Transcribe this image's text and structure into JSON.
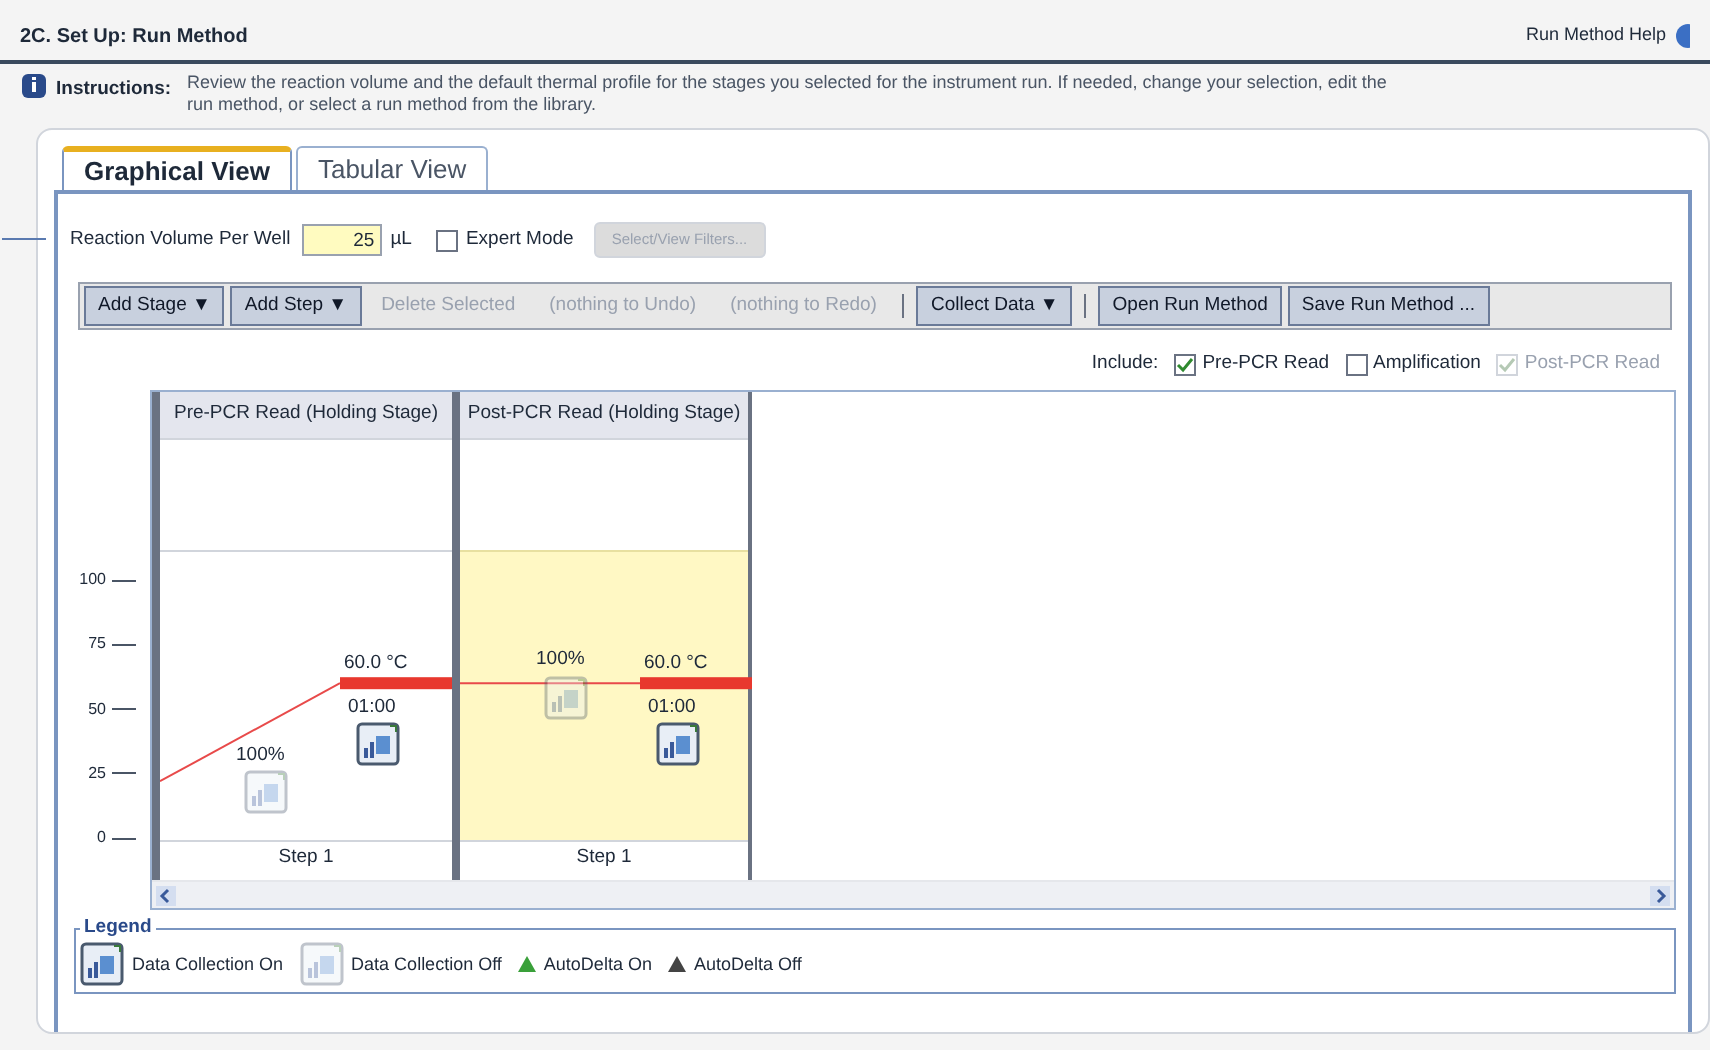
{
  "header": {
    "title": "2C. Set Up: Run Method",
    "help_link": "Run Method Help"
  },
  "instructions": {
    "label": "Instructions:",
    "text": "Review the reaction volume and the default thermal profile for the stages you selected for the instrument run. If needed, change your selection, edit the run method, or select a run method from the library."
  },
  "tabs": [
    {
      "label": "Graphical View",
      "selected": true
    },
    {
      "label": "Tabular View",
      "selected": false
    }
  ],
  "reaction_volume": {
    "label": "Reaction Volume Per Well",
    "value": "25",
    "unit": "µL"
  },
  "expert_mode": {
    "label": "Expert Mode",
    "checked": false
  },
  "filters_button": {
    "label": "Select/View Filters...",
    "disabled": true
  },
  "toolbar": [
    {
      "kind": "button",
      "label": "Add Stage ▼",
      "disabled": false
    },
    {
      "kind": "button",
      "label": "Add Step ▼",
      "disabled": false
    },
    {
      "kind": "button",
      "label": "Delete Selected",
      "disabled": true
    },
    {
      "kind": "button",
      "label": "(nothing to Undo)",
      "disabled": true
    },
    {
      "kind": "button",
      "label": "(nothing to Redo)",
      "disabled": true
    },
    {
      "kind": "separator"
    },
    {
      "kind": "button",
      "label": "Collect Data ▼",
      "disabled": false
    },
    {
      "kind": "separator"
    },
    {
      "kind": "button",
      "label": "Open Run Method",
      "disabled": false
    },
    {
      "kind": "button",
      "label": "Save Run Method ...",
      "disabled": false
    }
  ],
  "include": {
    "label": "Include:",
    "options": [
      {
        "label": "Pre-PCR Read",
        "checked": true,
        "disabled": false
      },
      {
        "label": "Amplification",
        "checked": false,
        "disabled": false
      },
      {
        "label": "Post-PCR Read",
        "checked": true,
        "disabled": true
      }
    ]
  },
  "y_ticks": [
    "100",
    "75",
    "50",
    "25",
    "0"
  ],
  "stages": [
    {
      "name": "Pre-PCR Read (Holding Stage)",
      "selected": false,
      "steps": [
        {
          "label": "Step 1",
          "temperature": "60.0 °C",
          "time": "01:00",
          "ramp": "100%",
          "ramp_collect": false,
          "hold_collect": true
        }
      ]
    },
    {
      "name": "Post-PCR Read (Holding Stage)",
      "selected": true,
      "steps": [
        {
          "label": "Step 1",
          "temperature": "60.0 °C",
          "time": "01:00",
          "ramp": "100%",
          "ramp_collect": false,
          "hold_collect": true
        }
      ]
    }
  ],
  "legend": {
    "title": "Legend",
    "items": [
      {
        "kind": "collect_on",
        "label": "Data Collection On"
      },
      {
        "kind": "collect_off",
        "label": "Data Collection Off"
      },
      {
        "kind": "delta_on",
        "label": "AutoDelta On"
      },
      {
        "kind": "delta_off",
        "label": "AutoDelta Off"
      }
    ]
  }
}
